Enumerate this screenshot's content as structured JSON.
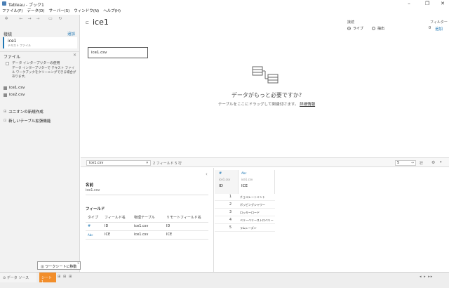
{
  "window": {
    "title": "Tableau - ブック1"
  },
  "menu": [
    "ファイル(F)",
    "データ(D)",
    "サーバー(S)",
    "ウィンドウ(N)",
    "ヘルプ(H)"
  ],
  "left": {
    "connections_label": "接続",
    "add_label": "追加",
    "connection": {
      "name": "ice1",
      "type": "テキスト ファイル"
    },
    "files_label": "ファイル",
    "interpreter_label": "データ インタープリターの使用",
    "interpreter_desc": "データ インタープリターで テキスト ファイル ワークブックをクリーニングできる場合があります。",
    "files": [
      "ice1.csv",
      "ice2.csv"
    ],
    "union_label": "ユニオンの新規作成",
    "new_table_ext_label": "新しいテーブル拡張機能"
  },
  "canvas": {
    "datasource_name": "ice1",
    "connection_label": "接続",
    "live_label": "ライブ",
    "extract_label": "抽出",
    "filter_label": "フィルター",
    "filter_count": "0",
    "filter_add": "追加",
    "table_name": "ice1.csv",
    "need_more_data": "データがもっと必要ですか?",
    "drag_hint": "テーブルをここにドラッグして関連付けます。",
    "details_link": "詳細情報"
  },
  "bottom": {
    "table_select": "ice1.csv",
    "field_count": "2 フィールド 5 行",
    "rows_value": "5",
    "rows_label": "行",
    "name_label": "名前",
    "name_value": "ice1.csv",
    "fields_label": "フィールド",
    "meta_headers": [
      "タイプ",
      "フィールド名",
      "物理テーブル",
      "リモートフィールド名"
    ],
    "meta_rows": [
      {
        "type": "#",
        "field": "ID",
        "table": "ice1.csv",
        "remote": "ID"
      },
      {
        "type": "Abc",
        "field": "ICE",
        "table": "ice1.csv",
        "remote": "ICE"
      }
    ],
    "grid_cols": [
      {
        "type": "#",
        "source": "ice1.csv",
        "name": "ID"
      },
      {
        "type": "Abc",
        "source": "ice1.csv",
        "name": "ICE"
      }
    ],
    "grid_rows": [
      [
        "1",
        "チョコレートミント"
      ],
      [
        "2",
        "ポッピングシャワー"
      ],
      [
        "3",
        "ロッキーロード"
      ],
      [
        "4",
        "ベリーベリーストロベリー"
      ],
      [
        "5",
        "ラムレーズン"
      ]
    ]
  },
  "status": {
    "datasource_tab": "データ ソース",
    "sheet_tab": "シート 1",
    "goto_sheet": "ワークシートに移動"
  }
}
